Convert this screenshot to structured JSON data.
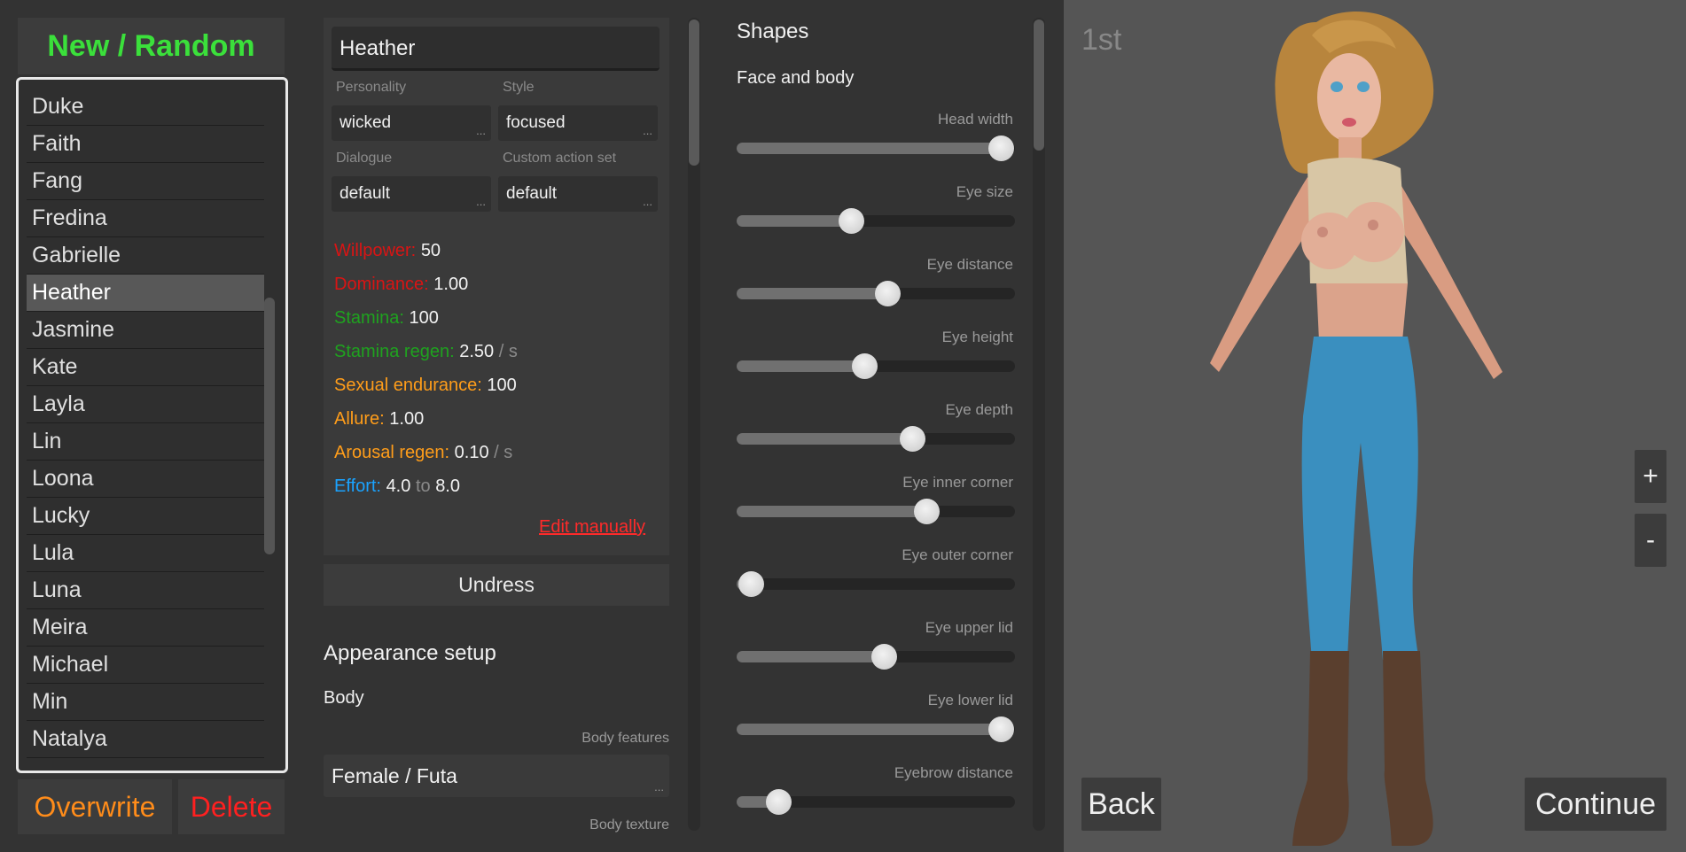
{
  "left_panel": {
    "new_random_label": "New / Random",
    "characters": [
      "Duke",
      "Faith",
      "Fang",
      "Fredina",
      "Gabrielle",
      "Heather",
      "Jasmine",
      "Kate",
      "Layla",
      "Lin",
      "Loona",
      "Lucky",
      "Lula",
      "Luna",
      "Meira",
      "Michael",
      "Min",
      "Natalya"
    ],
    "selected_character": "Heather",
    "overwrite_label": "Overwrite",
    "delete_label": "Delete"
  },
  "character": {
    "name": "Heather",
    "personality_label": "Personality",
    "personality_value": "wicked",
    "style_label": "Style",
    "style_value": "focused",
    "dialogue_label": "Dialogue",
    "dialogue_value": "default",
    "action_set_label": "Custom action set",
    "action_set_value": "default",
    "dots": "...",
    "stats": {
      "willpower": {
        "label": "Willpower:",
        "value": "50",
        "color": "#d91414"
      },
      "dominance": {
        "label": "Dominance:",
        "value": "1.00",
        "color": "#d91414"
      },
      "stamina": {
        "label": "Stamina:",
        "value": "100",
        "color": "#1fa21f"
      },
      "stamina_regen": {
        "label": "Stamina regen:",
        "value": "2.50",
        "unit": "/ s",
        "color": "#1fa21f"
      },
      "sexual_endurance": {
        "label": "Sexual endurance:",
        "value": "100",
        "color": "#ff9d1a"
      },
      "allure": {
        "label": "Allure:",
        "value": "1.00",
        "color": "#ff9d1a"
      },
      "arousal_regen": {
        "label": "Arousal regen:",
        "value": "0.10",
        "unit": "/ s",
        "color": "#ff9d1a"
      },
      "effort": {
        "label": "Effort:",
        "min": "4.0",
        "to": "to",
        "max": "8.0",
        "color": "#1aa3ff"
      }
    },
    "edit_manually_label": "Edit manually",
    "undress_label": "Undress"
  },
  "appearance": {
    "title": "Appearance setup",
    "body_label": "Body",
    "body_features_label": "Body features",
    "body_features_value": "Female / Futa",
    "body_texture_label": "Body texture"
  },
  "shapes": {
    "title": "Shapes",
    "subtitle": "Face and body",
    "sliders": [
      {
        "label": "Head width",
        "value": 0.95
      },
      {
        "label": "Eye size",
        "value": 0.41
      },
      {
        "label": "Eye distance",
        "value": 0.54
      },
      {
        "label": "Eye height",
        "value": 0.46
      },
      {
        "label": "Eye depth",
        "value": 0.63
      },
      {
        "label": "Eye inner corner",
        "value": 0.68
      },
      {
        "label": "Eye outer corner",
        "value": 0.05
      },
      {
        "label": "Eye upper lid",
        "value": 0.53
      },
      {
        "label": "Eye lower lid",
        "value": 0.95
      },
      {
        "label": "Eyebrow distance",
        "value": 0.15
      }
    ]
  },
  "viewport": {
    "view_label": "1st",
    "zoom_in": "+",
    "zoom_out": "-",
    "back_label": "Back",
    "continue_label": "Continue"
  }
}
